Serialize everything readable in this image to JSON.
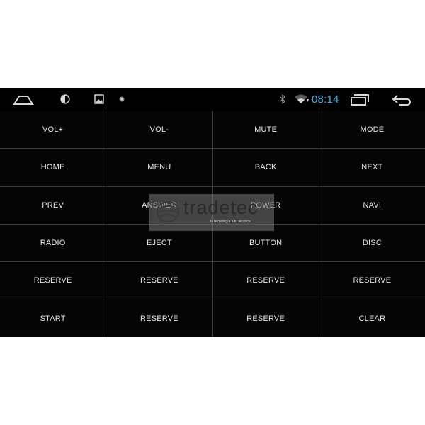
{
  "status_bar": {
    "left_icons": [
      "home-outline-icon",
      "brightness-icon",
      "gallery-icon",
      "dot-indicator-icon"
    ],
    "right_icons": [
      "bluetooth-icon",
      "wifi-icon",
      "recent-apps-icon",
      "back-arrow-icon"
    ],
    "time": "08:14",
    "time_color": "#33b5e5"
  },
  "keypad": {
    "rows": [
      [
        "VOL+",
        "VOL-",
        "MUTE",
        "MODE"
      ],
      [
        "HOME",
        "MENU",
        "BACK",
        "NEXT"
      ],
      [
        "PREV",
        "ANSWER",
        "POWER",
        "NAVI"
      ],
      [
        "RADIO",
        "EJECT",
        "BUTTON",
        "DISC"
      ],
      [
        "RESERVE",
        "RESERVE",
        "RESERVE",
        "RESERVE"
      ],
      [
        "START",
        "RESERVE",
        "RESERVE",
        "CLEAR"
      ]
    ]
  },
  "watermark": {
    "name": "tradetec",
    "tagline": "la tecnología a tu alcance"
  }
}
